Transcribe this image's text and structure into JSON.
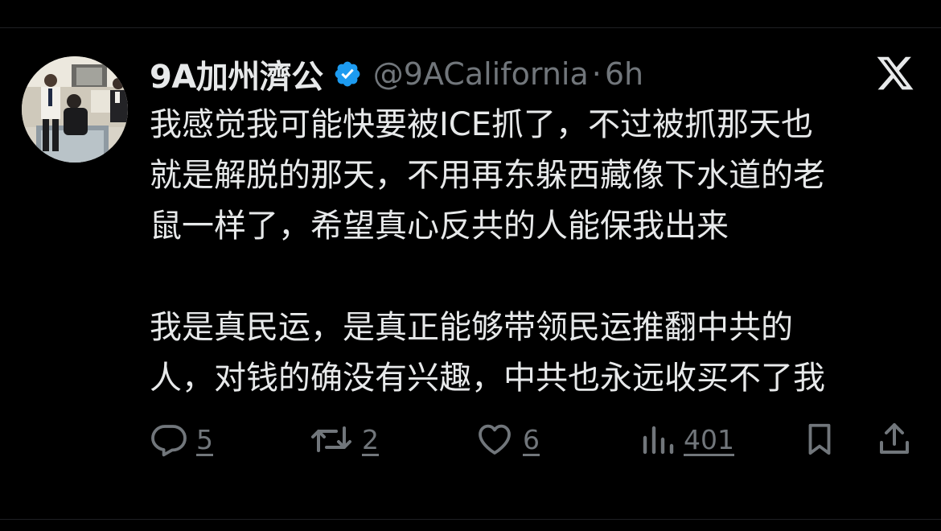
{
  "tweet": {
    "display_name": "9A加州濟公",
    "handle": "@9ACalifornia",
    "separator": "·",
    "time": "6h",
    "verified_icon": "verified-badge-icon",
    "brand_icon": "x-logo-icon",
    "paragraphs": [
      [
        "我感觉我可能快要被ICE抓了，不过被抓那天也",
        "就是解脱的那天，不用再东躲西藏像下水道的老",
        "鼠一样了，希望真心反共的人能保我出来"
      ],
      [
        "我是真民运，是真正能够带领民运推翻中共的",
        "人，对钱的确没有兴趣，中共也永远收买不了我"
      ]
    ]
  },
  "actions": {
    "reply": {
      "icon": "reply-icon",
      "count": "5"
    },
    "retweet": {
      "icon": "retweet-icon",
      "count": "2"
    },
    "like": {
      "icon": "heart-icon",
      "count": "6"
    },
    "views": {
      "icon": "views-icon",
      "count": "401"
    },
    "bookmark": {
      "icon": "bookmark-icon"
    },
    "share": {
      "icon": "share-icon"
    }
  },
  "colors": {
    "background": "#000000",
    "text": "#e7e9ea",
    "muted": "#71767b",
    "verified": "#1d9bf0"
  }
}
